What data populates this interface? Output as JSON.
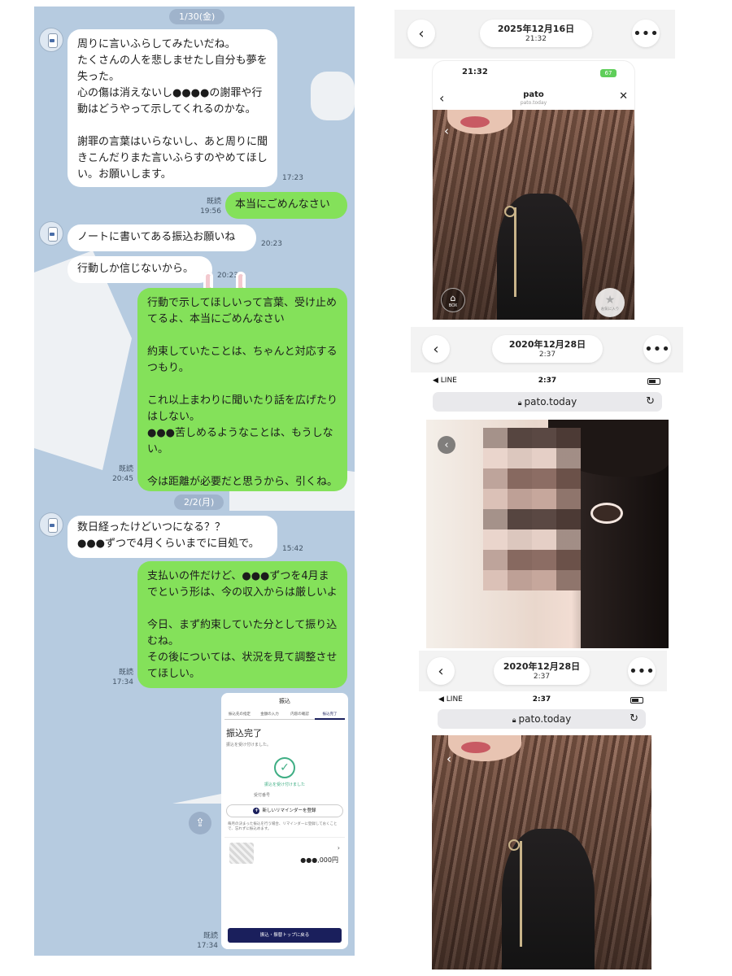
{
  "chat": {
    "date_1": "1/30(金)",
    "date_2": "2/2(月)",
    "messages": [
      {
        "dir": "in",
        "text": "周りに言いふらしてみたいだね。\nたくさんの人を悲しませたし自分も夢を失った。\n心の傷は消えないし●●●●の謝罪や行動はどうやって示してくれるのかな。\n\n謝罪の言葉はいらないし、あと周りに聞きこんだりまた言いふらすのやめてほしい。お願いします。",
        "time": "17:23"
      },
      {
        "dir": "out",
        "text": "本当にごめんなさい",
        "read": "既読",
        "time": "19:56"
      },
      {
        "dir": "in",
        "text": "ノートに書いてある振込お願いね",
        "time": "20:23"
      },
      {
        "dir": "in",
        "text": "行動しか信じないから。",
        "time": "20:23"
      },
      {
        "dir": "out",
        "text": "行動で示してほしいって言葉、受け止めてるよ、本当にごめんなさい\n\n約束していたことは、ちゃんと対応するつもり。\n\nこれ以上まわりに聞いたり話を広げたりはしない。\n●●●苦しめるようなことは、もうしない。\n\n今は距離が必要だと思うから、引くね。",
        "read": "既読",
        "time": "20:45"
      },
      {
        "dir": "in",
        "text": "数日経ったけどいつになる？？\n●●●ずつで4月くらいまでに目処で。",
        "time": "15:42"
      },
      {
        "dir": "out",
        "text": "支払いの件だけど、●●●ずつを4月までという形は、今の収入からは厳しいよ\n\n今日、まず約束していた分として振り込むね。\nその後については、状況を見て調整させてほしい。",
        "read": "既読",
        "time": "17:34"
      }
    ],
    "bank": {
      "title": "振込",
      "steps": [
        "振込先の指定",
        "金額の入力",
        "内容の確認",
        "振込完了"
      ],
      "done": "振込完了",
      "sub": "振込を受け付けました。",
      "ok": "振込を受け付けました",
      "receipt": "受付番号",
      "reminder": "新しいリマインダーを登録",
      "note": "毎月の決まった振込を行う場合、リマインダーに登録しておくことで、忘れずに振込めます。",
      "amount": "●●●,000円",
      "button": "振込・振替トップに戻る",
      "read": "既読",
      "time": "17:34"
    }
  },
  "shots": [
    {
      "date": "2025年12月16日",
      "time": "21:32",
      "status_time": "21:32",
      "battery": "67",
      "site": "pato",
      "site_sub": "pato.today",
      "box_label": "BOX",
      "fav_label": "お気に入り"
    },
    {
      "date": "2020年12月28日",
      "time": "2:37",
      "status_time": "2:37",
      "carrier": "◀ LINE",
      "url": "pato.today"
    },
    {
      "date": "2020年12月28日",
      "time": "2:37",
      "status_time": "2:37",
      "carrier": "◀ LINE",
      "url": "pato.today"
    }
  ],
  "icons": {
    "back": "back-chevron-icon",
    "more": "more-dots-icon",
    "close": "close-icon",
    "lock": "lock-icon",
    "reload": "reload-icon",
    "share": "share-icon",
    "gift": "gift-box-icon",
    "star": "star-icon"
  },
  "colors": {
    "chat_bg": "#b6cbe0",
    "bubble_out": "#84e15a",
    "bubble_in": "#ffffff",
    "bank_navy": "#1a1f5c"
  }
}
